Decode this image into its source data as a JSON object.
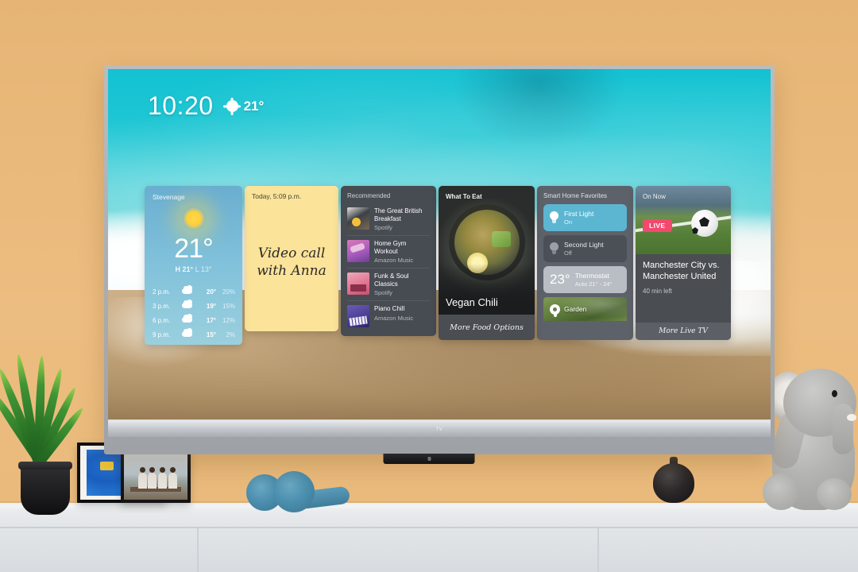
{
  "scene": {
    "description": "Smart TV home screen mounted on an orange wall above a white console",
    "wall_color": "#e9b97a"
  },
  "tv": {
    "brand_logo": "TV",
    "status_bar": {
      "clock": "10:20",
      "weather_icon": "sun-icon",
      "temperature": "21°"
    }
  },
  "weather_card": {
    "city": "Stevenage",
    "icon": "sun-icon",
    "current_temp": "21°",
    "high_label": "H",
    "high": "21°",
    "low_label": "L",
    "low": "13°",
    "forecast": [
      {
        "time": "2 p.m.",
        "icon": "cloud-icon",
        "temp": "20°",
        "precip": "20%"
      },
      {
        "time": "3 p.m.",
        "icon": "cloud-icon",
        "temp": "19°",
        "precip": "15%"
      },
      {
        "time": "6 p.m.",
        "icon": "cloud-icon",
        "temp": "17°",
        "precip": "12%"
      },
      {
        "time": "9 p.m.",
        "icon": "cloud-icon",
        "temp": "15°",
        "precip": "2%"
      }
    ]
  },
  "note_card": {
    "date": "Today, 5:09 p.m.",
    "text": "Video call with Anna"
  },
  "recommended_card": {
    "title": "Recommended",
    "items": [
      {
        "name": "The Great British Breakfast",
        "source": "Spotify",
        "art": "breakfast-pan-art"
      },
      {
        "name": "Home Gym Workout",
        "source": "Amazon Music",
        "art": "pink-gradient-art"
      },
      {
        "name": "Funk & Soul Classics",
        "source": "Spotify",
        "art": "pink-piano-art"
      },
      {
        "name": "Piano Chill",
        "source": "Amazon Music",
        "art": "purple-keys-art"
      }
    ]
  },
  "food_card": {
    "label": "What To Eat",
    "title": "Vegan Chili",
    "footer": "More Food Options",
    "image": "vegan-chili-bowl-photo"
  },
  "smart_home_card": {
    "title": "Smart Home Favorites",
    "devices": [
      {
        "name": "First Light",
        "state": "On",
        "icon": "lightbulb-icon",
        "active": true,
        "accent": "#5cb6d2"
      },
      {
        "name": "Second Light",
        "state": "Off",
        "icon": "lightbulb-icon",
        "active": false
      },
      {
        "name": "Thermostat",
        "value": "23°",
        "state": "Auto 21° - 24°",
        "icon": "thermostat-icon"
      }
    ],
    "camera": {
      "name": "Garden",
      "icon": "camera-icon"
    }
  },
  "live_card": {
    "label": "On Now",
    "badge": "LIVE",
    "badge_color": "#f2496e",
    "title": "Manchester City vs. Manchester United",
    "time_left": "40 min left",
    "footer": "More Live TV",
    "image": "football-pitch-photo"
  },
  "room_objects": {
    "plant": "snake-plant",
    "frames": [
      "blue-abstract-art",
      "people-on-bench-photo"
    ],
    "headphones": "blue-headphones",
    "vase": "black-ceramic-vase",
    "toy": "grey-plush-elephant"
  }
}
